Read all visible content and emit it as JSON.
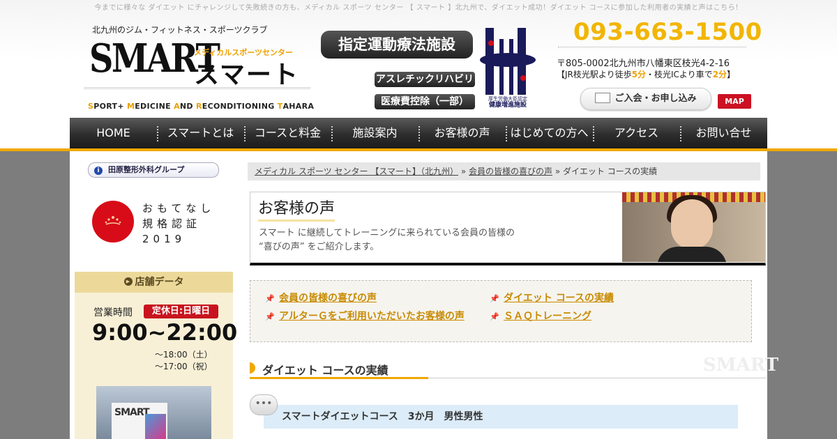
{
  "header": {
    "top_text": "今までに様々な ダイエット にチャレンジして失敗続きの方も、メディカル スポーツ センター 【 スマート 】北九州で、ダイエット成功！ダイエット コースに参加した利用者の実績と声はこちら！",
    "tagline": "北九州のジム・フィットネス・スポーツクラブ",
    "logo_en": "SMART",
    "logo_sub": "メディカルスポーツセンター",
    "logo_ja": "スマート",
    "logo_tag_parts": [
      {
        "initial": "S",
        "rest": "PORT+ "
      },
      {
        "initial": "M",
        "rest": "EDICINE "
      },
      {
        "initial": "A",
        "rest": "ND "
      },
      {
        "initial": "R",
        "rest": "ECONDITIONING "
      },
      {
        "initial": "T",
        "rest": "AHARA"
      }
    ],
    "badge_main": "指定運動療法施設",
    "badge_1": "アスレチックリハビリ",
    "badge_2": "医療費控除（一部）",
    "hlogo_caption_1": "厚生労働大臣認定",
    "hlogo_caption_2": "健康増進施設",
    "phone": "093-663-1500",
    "address": "〒805-0002北九州市八幡東区枝光4-2-16",
    "access": {
      "prefix": "【JR枝光駅より徒歩",
      "walk": "5分",
      "mid": "・枝光ICより車で",
      "drive": "2分",
      "suffix": "】"
    },
    "join_label": "ご入会・お申し込み",
    "map_label": "MAP"
  },
  "nav": {
    "items": [
      "HOME",
      "スマートとは",
      "コースと料金",
      "施設案内",
      "お客様の声",
      "はじめての方へ",
      "アクセス",
      "お問い合せ"
    ]
  },
  "sidebar": {
    "group_label": "田原整形外科グループ",
    "omotenashi": [
      "おもてなし",
      "規格認証",
      "2019"
    ],
    "store_head": "店舗データ",
    "hours_label": "営業時間",
    "holiday": "定休日:日曜日",
    "hours_main": "9:00~22:00",
    "hours_sat": "～18:00（土）",
    "hours_hol": "～17:00（祝）",
    "photo_sign": "SMART"
  },
  "breadcrumb": {
    "home": "メディカル スポーツ センター 【スマート】（北九州）",
    "sep1": " » ",
    "parent": "会員の皆様の喜びの声",
    "sep2": " » ",
    "current": "ダイエット コースの実績"
  },
  "voice": {
    "title": "お客様の声",
    "desc_line1": "スマート に継続してトレーニングに来られている会員の皆様の",
    "desc_line2": "“喜びの声” をご紹介します。"
  },
  "links": [
    "会員の皆様の喜びの声",
    "ダイエット コースの実績",
    "アルターＧをご利用いただいたお客様の声",
    "ＳＡＱトレーニング"
  ],
  "section": {
    "title": "ダイエット コースの実績",
    "watermark": "SMART"
  },
  "course": {
    "title": "スマートダイエットコース　3か月　男性男性"
  },
  "colors": {
    "accent": "#f0a800",
    "nav_bg": "#2d2d2d",
    "holiday_red": "#c8141e",
    "map_red": "#cc1122",
    "link": "#c88a00"
  }
}
